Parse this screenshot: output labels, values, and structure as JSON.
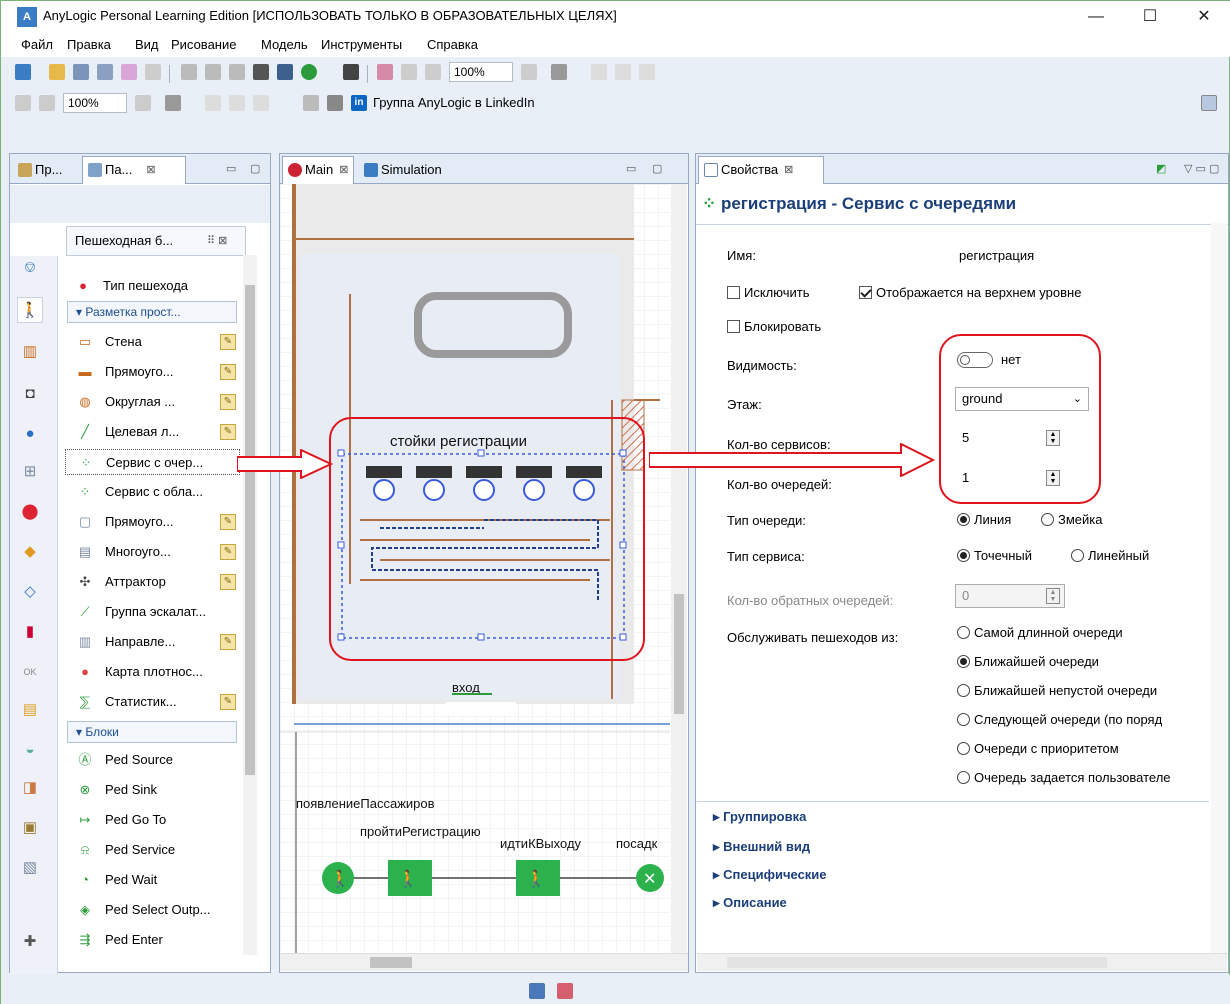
{
  "window": {
    "logo": "A",
    "title": "AnyLogic Personal Learning Edition [ИСПОЛЬЗОВАТЬ ТОЛЬКО В ОБРАЗОВАТЕЛЬНЫХ ЦЕЛЯХ]",
    "controls": [
      "—",
      "☐",
      "✕"
    ]
  },
  "menu": [
    "Файл",
    "Правка",
    "Вид",
    "Рисование",
    "Модель",
    "Инструменты",
    "Справка"
  ],
  "toolbar": {
    "zoom1": "100%",
    "zoom2": "100%",
    "linkedin": "Группа AnyLogic в LinkedIn"
  },
  "left_panel": {
    "tabs": [
      "Пр...",
      "Па..."
    ],
    "palette_title": "Пешеходная б...",
    "top_item": "Тип пешехода",
    "group1": "Разметка прост...",
    "items1": [
      "Стена",
      "Прямоуго...",
      "Округлая ...",
      "Целевая л...",
      "Сервис с очер...",
      "Сервис с обла...",
      "Прямоуго...",
      "Многоуго...",
      "Аттрактор",
      "Группа эскалат...",
      "Направле...",
      "Карта плотнос...",
      "Статистик..."
    ],
    "group2": "Блоки",
    "items2": [
      "Ped Source",
      "Ped Sink",
      "Ped Go To",
      "Ped Service",
      "Ped Wait",
      "Ped Select Outp...",
      "Ped Enter"
    ]
  },
  "editor": {
    "tabs": [
      "Main",
      "Simulation"
    ],
    "area_label": "стойки регистрации",
    "entrance": "вход",
    "flow": [
      "появлениеПассажиров",
      "пройтиРегистрацию",
      "идтиКВыходу",
      "посадк"
    ]
  },
  "properties": {
    "tab": "Свойства",
    "header": "регистрация - Сервис с очередями",
    "name_label": "Имя:",
    "name_value": "регистрация",
    "exclude": "Исключить",
    "top_level": "Отображается на верхнем уровне",
    "lock": "Блокировать",
    "visibility_label": "Видимость:",
    "visibility_value": "нет",
    "floor_label": "Этаж:",
    "floor_value": "ground",
    "services_label": "Кол-во сервисов:",
    "services_value": "5",
    "queues_label": "Кол-во очередей:",
    "queues_value": "1",
    "queue_type_label": "Тип очереди:",
    "queue_type_opts": [
      "Линия",
      "Змейка"
    ],
    "service_type_label": "Тип сервиса:",
    "service_type_opts": [
      "Точечный",
      "Линейный"
    ],
    "reverse_label": "Кол-во обратных очередей:",
    "reverse_value": "0",
    "serve_label": "Обслуживать пешеходов из:",
    "serve_opts": [
      "Самой длинной очереди",
      "Ближайшей очереди",
      "Ближайшей непустой очереди",
      "Следующей очереди (по поряд",
      "Очереди с приоритетом",
      "Очередь задается пользователе"
    ],
    "sections": [
      "Группировка",
      "Внешний вид",
      "Специфические",
      "Описание"
    ]
  },
  "colors": {
    "accent_red": "#e0141e",
    "green_block": "#2bb24c",
    "title_blue": "#1b3f7a"
  }
}
